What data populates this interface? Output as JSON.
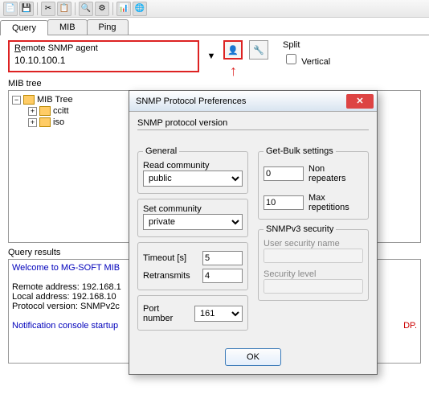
{
  "tabs": {
    "query": "Query",
    "mib": "MIB",
    "ping": "Ping"
  },
  "agent": {
    "label": "Remote SNMP agent",
    "value": "10.10.100.1"
  },
  "split": {
    "label": "Split",
    "vertical": "Vertical"
  },
  "mibtree": {
    "label": "MIB tree",
    "root": "MIB Tree",
    "children": [
      "ccitt",
      "iso"
    ]
  },
  "results": {
    "label": "Query results",
    "welcome": "Welcome to MG-SOFT MIB",
    "remote": "Remote address: 192.168.1",
    "local": "Local address: 192.168.10",
    "proto": "Protocol version: SNMPv2c",
    "notif": "Notification console startup",
    "dp": "DP."
  },
  "dialog": {
    "title": "SNMP Protocol Preferences",
    "section": "SNMP protocol version",
    "general": {
      "legend": "General",
      "read_label": "Read community",
      "read_value": "public",
      "set_label": "Set community",
      "set_value": "private",
      "timeout_label": "Timeout [s]",
      "timeout_value": "5",
      "retrans_label": "Retransmits",
      "retrans_value": "4",
      "port_label": "Port number",
      "port_value": "161"
    },
    "getbulk": {
      "legend": "Get-Bulk settings",
      "nonrep_label": "Non repeaters",
      "nonrep_value": "0",
      "maxrep_label": "Max repetitions",
      "maxrep_value": "10"
    },
    "v3": {
      "legend": "SNMPv3 security",
      "user_label": "User security name",
      "level_label": "Security level"
    },
    "ok": "OK"
  }
}
